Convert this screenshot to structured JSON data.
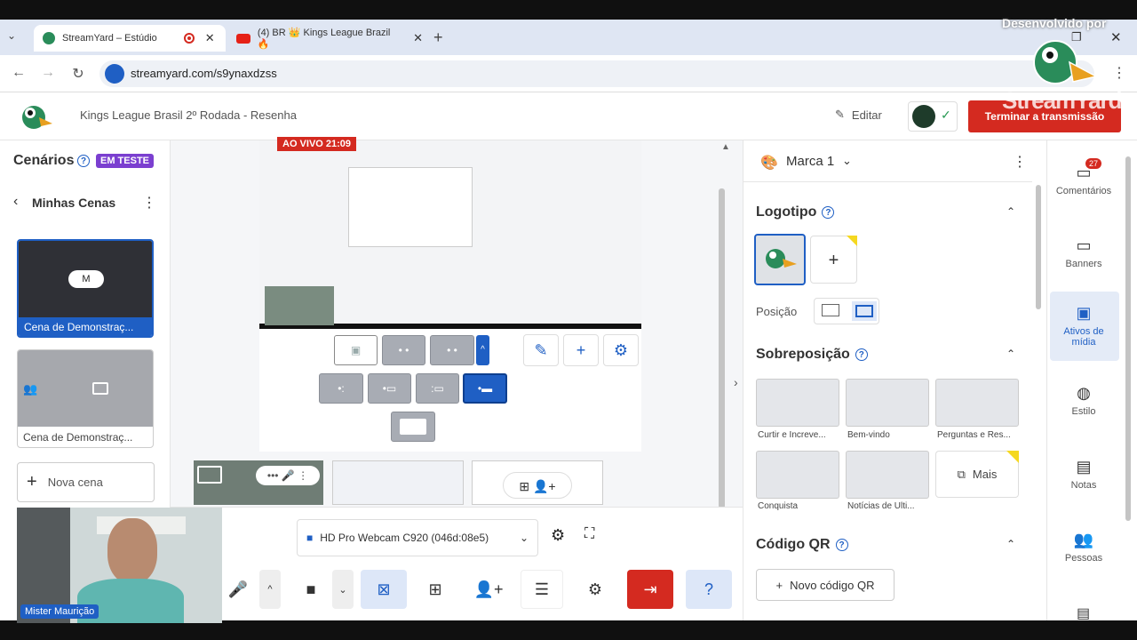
{
  "browser": {
    "tabs": [
      {
        "title": "StreamYard – Estúdio",
        "active": true
      },
      {
        "title": "(4) BR 👑 Kings League Brazil 🔥",
        "active": false
      }
    ],
    "url": "streamyard.com/s9ynaxdzss"
  },
  "watermark": {
    "line1": "Desenvolvido por",
    "line2": "StreamYard"
  },
  "header": {
    "broadcast_title": "Kings League Brasil 2º Rodada - Resenha",
    "edit_label": "Editar",
    "end_label": "Terminar a transmissão"
  },
  "left": {
    "title": "Cenários",
    "badge": "EM TESTE",
    "subheader": "Minhas Cenas",
    "scenes": [
      {
        "label": "Cena de Demonstraç...",
        "active": true,
        "badge": "M"
      },
      {
        "label": "Cena de Demonstraç...",
        "active": false
      }
    ],
    "new_scene": "Nova cena"
  },
  "preview": {
    "live_label": "AO VIVO 21:09"
  },
  "bottom": {
    "camera_select": "HD Pro Webcam C920 (046d:08e5)"
  },
  "webcam": {
    "name": "Mister Maurição"
  },
  "right": {
    "brand": "Marca 1",
    "logo_title": "Logotipo",
    "position_label": "Posição",
    "overlay_title": "Sobreposição",
    "overlays": [
      {
        "label": "Curtir e Increve..."
      },
      {
        "label": "Bem-vindo"
      },
      {
        "label": "Perguntas e Res..."
      },
      {
        "label": "Conquista"
      },
      {
        "label": "Notícias de Ulti..."
      }
    ],
    "more_label": "Mais",
    "qr_title": "Código QR",
    "new_qr": "Novo código QR"
  },
  "sidenav": {
    "comments_count": "27",
    "items": [
      {
        "label": "Comentários",
        "icon": "chat-icon"
      },
      {
        "label": "Banners",
        "icon": "banner-icon"
      },
      {
        "label": "Ativos de mídia",
        "icon": "image-icon",
        "active": true
      },
      {
        "label": "Estilo",
        "icon": "palette-icon"
      },
      {
        "label": "Notas",
        "icon": "notes-icon"
      },
      {
        "label": "Pessoas",
        "icon": "people-icon"
      }
    ]
  },
  "colors": {
    "accent": "#1f5fc4",
    "danger": "#d42a20",
    "badge": "#7b3fd0"
  }
}
